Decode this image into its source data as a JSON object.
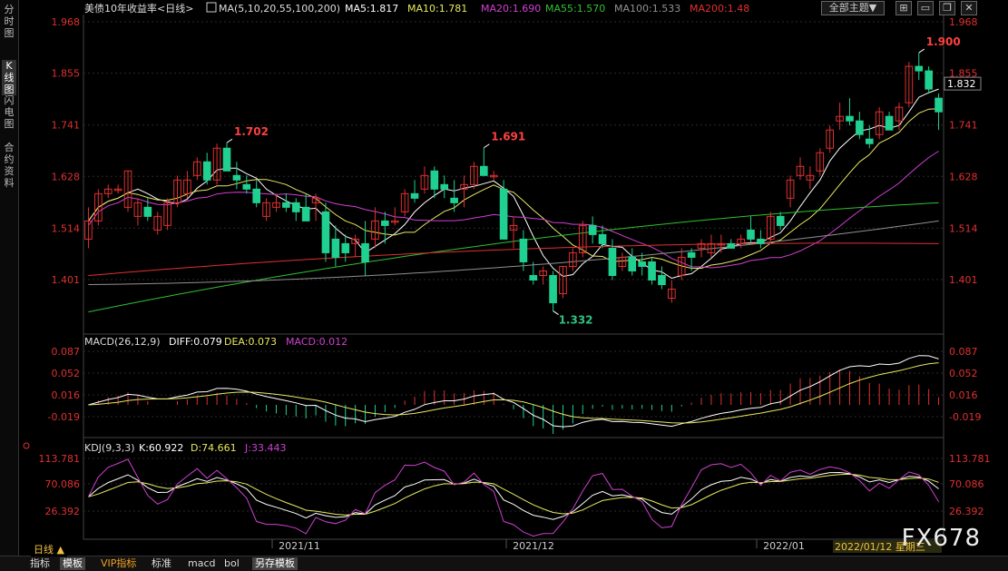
{
  "sidebar": {
    "tabs": [
      {
        "label": "分时图",
        "active": false
      },
      {
        "label": "K线图",
        "active": true
      },
      {
        "label": "闪电图",
        "active": false
      },
      {
        "label": "合约资料",
        "active": false
      }
    ]
  },
  "header": {
    "title": "美债10年收益率",
    "period": "<日线>",
    "ma_label": "MA(5,10,20,55,100,200)",
    "ma": [
      {
        "text": "MA5:1.817",
        "color": "#ffffff"
      },
      {
        "text": "MA10:1.781",
        "color": "#e8e860"
      },
      {
        "text": "MA20:1.690",
        "color": "#d040d0"
      },
      {
        "text": "MA55:1.570",
        "color": "#30c030"
      },
      {
        "text": "MA100:1.533",
        "color": "#909090"
      },
      {
        "text": "MA200:1.48",
        "color": "#e03030"
      }
    ],
    "theme_select": "全部主题▼",
    "window_icons": [
      "grid-icon",
      "minimize-icon",
      "restore-icon",
      "close-icon"
    ]
  },
  "price_axis": {
    "ticks": [
      "1.968",
      "1.855",
      "1.741",
      "1.628",
      "1.514",
      "1.401"
    ],
    "current": "1.832"
  },
  "annotations": {
    "high1": "1.702",
    "high2": "1.691",
    "low": "1.332",
    "high3": "1.900"
  },
  "macd": {
    "label": "MACD(26,12,9)",
    "diff": "DIFF:0.079",
    "dea": "DEA:0.073",
    "macd": "MACD:0.012",
    "ticks": [
      "0.087",
      "0.052",
      "0.016",
      "-0.019"
    ]
  },
  "kdj": {
    "label": "KDJ(9,3,3)",
    "k": "K:60.922",
    "d": "D:74.661",
    "j": "J:33.443",
    "ticks": [
      "113.781",
      "70.086",
      "26.392"
    ]
  },
  "dates": [
    "2021/11",
    "2021/12",
    "2022/01"
  ],
  "cursor_date": "2022/01/12 星期三",
  "period_selector": "日线 ▲",
  "bottom_tabs": [
    {
      "label": "指标",
      "active": false,
      "vip": false
    },
    {
      "label": "模板",
      "active": true,
      "vip": false
    },
    {
      "label": "VIP指标",
      "active": false,
      "vip": true
    },
    {
      "label": "标准",
      "active": false,
      "vip": false
    },
    {
      "label": "macd",
      "active": false,
      "vip": false
    },
    {
      "label": "bol",
      "active": false,
      "vip": false
    },
    {
      "label": "另存模板",
      "active": true,
      "vip": false
    }
  ],
  "watermark": "FX678",
  "colors": {
    "up": "#e03030",
    "down": "#20d090",
    "axis": "#e03030",
    "grid": "#2a2a2a"
  },
  "chart_data": {
    "type": "candlestick",
    "price_range": [
      1.3,
      2.0
    ],
    "candles": [
      [
        1.49,
        1.56,
        1.47,
        1.53
      ],
      [
        1.53,
        1.6,
        1.52,
        1.59
      ],
      [
        1.59,
        1.61,
        1.58,
        1.6
      ],
      [
        1.6,
        1.61,
        1.59,
        1.6
      ],
      [
        1.56,
        1.64,
        1.55,
        1.64
      ],
      [
        1.54,
        1.58,
        1.52,
        1.57
      ],
      [
        1.56,
        1.58,
        1.53,
        1.54
      ],
      [
        1.51,
        1.55,
        1.5,
        1.54
      ],
      [
        1.52,
        1.58,
        1.51,
        1.57
      ],
      [
        1.57,
        1.63,
        1.56,
        1.62
      ],
      [
        1.59,
        1.64,
        1.58,
        1.62
      ],
      [
        1.63,
        1.67,
        1.62,
        1.66
      ],
      [
        1.66,
        1.68,
        1.61,
        1.62
      ],
      [
        1.62,
        1.7,
        1.61,
        1.69
      ],
      [
        1.69,
        1.702,
        1.64,
        1.64
      ],
      [
        1.63,
        1.66,
        1.6,
        1.62
      ],
      [
        1.61,
        1.63,
        1.59,
        1.6
      ],
      [
        1.6,
        1.62,
        1.56,
        1.57
      ],
      [
        1.54,
        1.58,
        1.53,
        1.57
      ],
      [
        1.56,
        1.59,
        1.55,
        1.57
      ],
      [
        1.57,
        1.59,
        1.55,
        1.56
      ],
      [
        1.57,
        1.58,
        1.53,
        1.55
      ],
      [
        1.56,
        1.59,
        1.53,
        1.53
      ],
      [
        1.57,
        1.59,
        1.53,
        1.58
      ],
      [
        1.55,
        1.57,
        1.44,
        1.46
      ],
      [
        1.49,
        1.52,
        1.43,
        1.45
      ],
      [
        1.48,
        1.5,
        1.44,
        1.46
      ],
      [
        1.48,
        1.5,
        1.45,
        1.49
      ],
      [
        1.48,
        1.53,
        1.41,
        1.44
      ],
      [
        1.49,
        1.56,
        1.47,
        1.53
      ],
      [
        1.53,
        1.55,
        1.48,
        1.52
      ],
      [
        1.53,
        1.56,
        1.52,
        1.53
      ],
      [
        1.55,
        1.6,
        1.54,
        1.59
      ],
      [
        1.59,
        1.62,
        1.57,
        1.58
      ],
      [
        1.6,
        1.65,
        1.59,
        1.63
      ],
      [
        1.64,
        1.65,
        1.58,
        1.6
      ],
      [
        1.61,
        1.63,
        1.58,
        1.6
      ],
      [
        1.58,
        1.62,
        1.55,
        1.57
      ],
      [
        1.6,
        1.63,
        1.56,
        1.61
      ],
      [
        1.61,
        1.66,
        1.6,
        1.65
      ],
      [
        1.65,
        1.691,
        1.63,
        1.63
      ],
      [
        1.63,
        1.64,
        1.62,
        1.63
      ],
      [
        1.6,
        1.62,
        1.49,
        1.49
      ],
      [
        1.51,
        1.54,
        1.47,
        1.52
      ],
      [
        1.49,
        1.51,
        1.42,
        1.44
      ],
      [
        1.41,
        1.44,
        1.39,
        1.4
      ],
      [
        1.41,
        1.43,
        1.39,
        1.42
      ],
      [
        1.41,
        1.42,
        1.332,
        1.35
      ],
      [
        1.37,
        1.43,
        1.36,
        1.43
      ],
      [
        1.43,
        1.47,
        1.42,
        1.46
      ],
      [
        1.46,
        1.53,
        1.45,
        1.52
      ],
      [
        1.52,
        1.54,
        1.48,
        1.5
      ],
      [
        1.5,
        1.52,
        1.47,
        1.48
      ],
      [
        1.47,
        1.49,
        1.4,
        1.41
      ],
      [
        1.43,
        1.46,
        1.42,
        1.45
      ],
      [
        1.45,
        1.47,
        1.41,
        1.42
      ],
      [
        1.44,
        1.46,
        1.41,
        1.43
      ],
      [
        1.44,
        1.45,
        1.39,
        1.4
      ],
      [
        1.41,
        1.43,
        1.38,
        1.39
      ],
      [
        1.36,
        1.4,
        1.35,
        1.38
      ],
      [
        1.41,
        1.47,
        1.4,
        1.45
      ],
      [
        1.46,
        1.47,
        1.42,
        1.45
      ],
      [
        1.47,
        1.49,
        1.45,
        1.48
      ],
      [
        1.46,
        1.5,
        1.45,
        1.48
      ],
      [
        1.48,
        1.5,
        1.46,
        1.48
      ],
      [
        1.48,
        1.49,
        1.47,
        1.47
      ],
      [
        1.48,
        1.5,
        1.47,
        1.49
      ],
      [
        1.51,
        1.54,
        1.48,
        1.49
      ],
      [
        1.49,
        1.51,
        1.47,
        1.48
      ],
      [
        1.49,
        1.55,
        1.48,
        1.54
      ],
      [
        1.54,
        1.55,
        1.51,
        1.52
      ],
      [
        1.58,
        1.63,
        1.56,
        1.62
      ],
      [
        1.63,
        1.67,
        1.62,
        1.65
      ],
      [
        1.62,
        1.65,
        1.6,
        1.63
      ],
      [
        1.64,
        1.69,
        1.63,
        1.68
      ],
      [
        1.69,
        1.74,
        1.68,
        1.73
      ],
      [
        1.75,
        1.79,
        1.73,
        1.76
      ],
      [
        1.76,
        1.8,
        1.74,
        1.75
      ],
      [
        1.75,
        1.77,
        1.71,
        1.72
      ],
      [
        1.71,
        1.74,
        1.69,
        1.7
      ],
      [
        1.72,
        1.78,
        1.71,
        1.77
      ],
      [
        1.76,
        1.77,
        1.73,
        1.73
      ],
      [
        1.75,
        1.79,
        1.73,
        1.78
      ],
      [
        1.79,
        1.88,
        1.78,
        1.87
      ],
      [
        1.87,
        1.9,
        1.84,
        1.86
      ],
      [
        1.86,
        1.87,
        1.81,
        1.82
      ],
      [
        1.8,
        1.81,
        1.73,
        1.77
      ]
    ]
  }
}
